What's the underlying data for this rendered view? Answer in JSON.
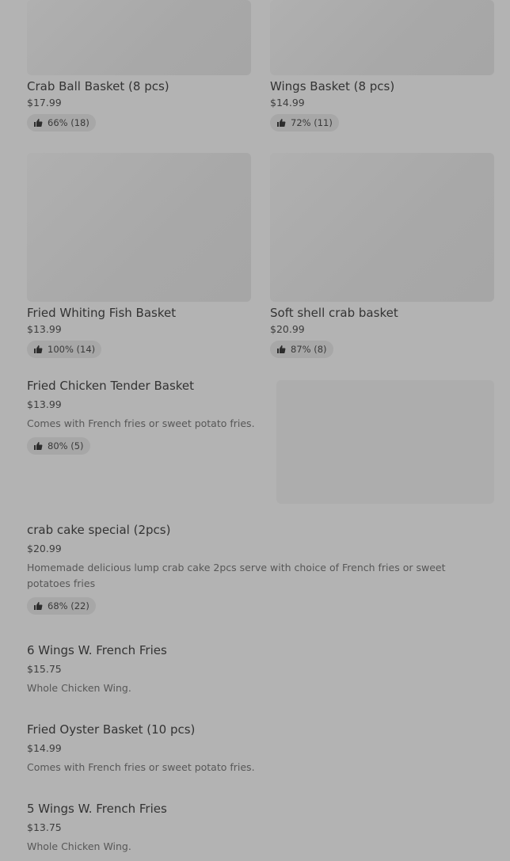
{
  "grid": [
    {
      "title": "Crab Ball Basket (8 pcs)",
      "price": "$17.99",
      "rating": "66% (18)"
    },
    {
      "title": "Wings Basket (8 pcs)",
      "price": "$14.99",
      "rating": "72% (11)"
    },
    {
      "title": "Fried Whiting Fish Basket",
      "price": "$13.99",
      "rating": "100% (14)"
    },
    {
      "title": "Soft shell crab basket",
      "price": "$20.99",
      "rating": "87% (8)"
    }
  ],
  "items": [
    {
      "title": "Fried Chicken Tender Basket",
      "price": "$13.99",
      "desc": "Comes with French fries or sweet potato fries.",
      "rating": "80% (5)"
    },
    {
      "title": "crab cake special (2pcs)",
      "price": "$20.99",
      "desc": "Homemade delicious lump crab cake 2pcs serve with choice of French fries or sweet potatoes fries",
      "rating": "68% (22)"
    },
    {
      "title": "6 Wings W. French Fries",
      "price": "$15.75",
      "desc": "Whole Chicken Wing."
    },
    {
      "title": "Fried Oyster Basket (10 pcs)",
      "price": "$14.99",
      "desc": "Comes with French fries or sweet potato fries."
    },
    {
      "title": "5 Wings W. French Fries",
      "price": "$13.75",
      "desc": "Whole Chicken Wing."
    }
  ],
  "icons": {
    "rating": "thumbs-up-icon"
  }
}
